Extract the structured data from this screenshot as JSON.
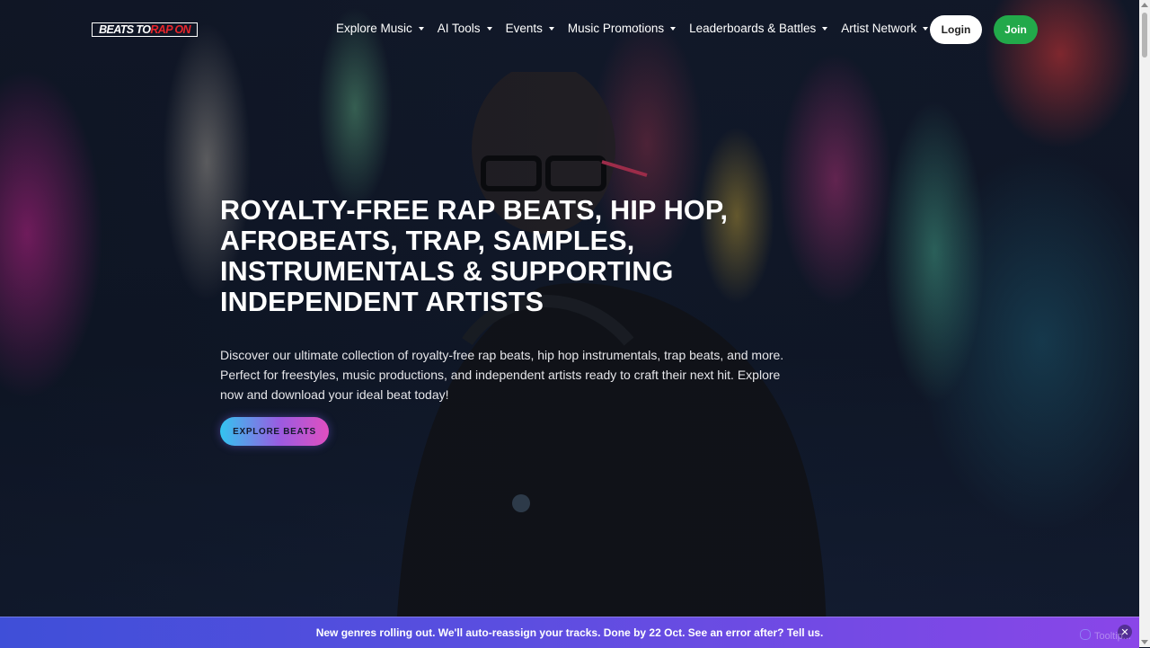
{
  "brand": {
    "logo_part1": "BEATS TO ",
    "logo_part2": "RAP ON"
  },
  "nav": {
    "items": [
      {
        "label": "Explore Music"
      },
      {
        "label": "AI Tools"
      },
      {
        "label": "Events"
      },
      {
        "label": "Music Promotions"
      },
      {
        "label": "Leaderboards & Battles"
      },
      {
        "label": "Artist Network"
      }
    ],
    "login_label": "Login",
    "join_label": "Join"
  },
  "hero": {
    "title": "ROYALTY-FREE RAP BEATS, HIP HOP, AFROBEATS, TRAP, SAMPLES, INSTRUMENTALS & SUPPORTING INDEPENDENT ARTISTS",
    "description": "Discover our ultimate collection of royalty-free rap beats, hip hop instrumentals, trap beats, and more. Perfect for freestyles, music productions, and independent artists ready to craft their next hit. Explore now and download your ideal beat today!",
    "cta_label": "EXPLORE BEATS"
  },
  "announcement": {
    "text": "New genres rolling out. We'll auto-reassign your tracks. Done by 22 Oct. See an error after? Tell us.",
    "close_symbol": "✕"
  },
  "watermark": {
    "text": "Tooltip..."
  },
  "colors": {
    "brand_red": "#e8252b",
    "join_green": "#22a94a",
    "announce_start": "#3f4fd8",
    "announce_end": "#8a46e8",
    "cta_start": "#33c4f0",
    "cta_end": "#e04fc0"
  }
}
